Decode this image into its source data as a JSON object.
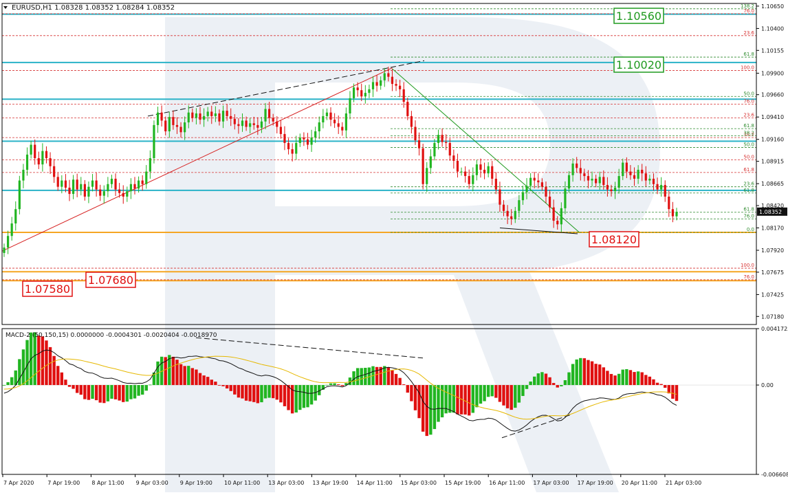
{
  "header": {
    "symbol_line": "EURUSD,H1  1.08328 1.08352 1.08284 1.08352",
    "macd_line": "MACD-2 (50,150,15) 0.0000000 -0.0004301 -0.0020404 -0.0018970"
  },
  "colors": {
    "bull": "#21b521",
    "bear": "#e01010",
    "level_cyan": "#2ab3c8",
    "level_orange": "#f5a623",
    "fib_red": "#d63030",
    "fib_green": "#2e8b2e",
    "trend_red": "#d62020",
    "trend_green": "#1f9a1f",
    "watermark": "#e9edf3"
  },
  "chart_data": [
    {
      "type": "candlestick",
      "title": "EURUSD,H1",
      "ylim": [
        1.0709,
        1.1068
      ],
      "y_ticks": [
        "1.10650",
        "1.10400",
        "1.10155",
        "1.09900",
        "1.09660",
        "1.09410",
        "1.09160",
        "1.08915",
        "1.08665",
        "1.08420",
        "1.08170",
        "1.07920",
        "1.07675",
        "1.07425",
        "1.07180"
      ],
      "x_ticks": [
        "7 Apr 2020",
        "7 Apr 19:00",
        "8 Apr 11:00",
        "9 Apr 03:00",
        "9 Apr 19:00",
        "10 Apr 11:00",
        "13 Apr 03:00",
        "13 Apr 19:00",
        "14 Apr 11:00",
        "15 Apr 03:00",
        "15 Apr 19:00",
        "16 Apr 11:00",
        "17 Apr 03:00",
        "17 Apr 19:00",
        "20 Apr 11:00",
        "21 Apr 03:00"
      ],
      "current_price": "1.08352",
      "series": [
        {
          "values": [
            1.0795,
            1.0808,
            1.0822,
            1.0838,
            1.087,
            1.0882,
            1.0899,
            1.091,
            1.0895,
            1.0888,
            1.0903,
            1.0895,
            1.0886,
            1.0874,
            1.0863,
            1.087,
            1.0862,
            1.0855,
            1.0871,
            1.086,
            1.0866,
            1.0852,
            1.0863,
            1.087,
            1.086,
            1.0853,
            1.0858,
            1.0866,
            1.0872,
            1.086,
            1.0856,
            1.0852,
            1.0858,
            1.0866,
            1.0861,
            1.087,
            1.0866,
            1.088,
            1.0895,
            1.0932,
            1.0946,
            1.0937,
            1.0925,
            1.0941,
            1.0932,
            1.093,
            1.0924,
            1.0935,
            1.0946,
            1.094,
            1.0945,
            1.0938,
            1.0942,
            1.0947,
            1.0942,
            1.0945,
            1.0936,
            1.0948,
            1.0942,
            1.0939,
            1.0933,
            1.0931,
            1.0937,
            1.093,
            1.0934,
            1.0932,
            1.0929,
            1.0936,
            1.095,
            1.094,
            1.0936,
            1.093,
            1.0922,
            1.0912,
            1.0905,
            1.09,
            1.0912,
            1.0918,
            1.0916,
            1.091,
            1.0918,
            1.0925,
            1.0935,
            1.0942,
            1.0946,
            1.0938,
            1.0934,
            1.093,
            1.0926,
            1.0945,
            1.0962,
            1.0974,
            1.0971,
            1.0964,
            1.0968,
            1.0972,
            1.098,
            1.0976,
            1.0982,
            1.099,
            1.0986,
            1.0978,
            1.0976,
            1.0972,
            1.0958,
            1.0942,
            1.093,
            1.0915,
            1.0906,
            1.0866,
            1.0884,
            1.0897,
            1.0912,
            1.0921,
            1.0913,
            1.0912,
            1.0898,
            1.0892,
            1.088,
            1.088,
            1.0875,
            1.0866,
            1.0876,
            1.0888,
            1.0882,
            1.0878,
            1.0886,
            1.0872,
            1.086,
            1.0843,
            1.0836,
            1.083,
            1.0827,
            1.0836,
            1.0848,
            1.0857,
            1.0864,
            1.0873,
            1.087,
            1.0868,
            1.0863,
            1.0852,
            1.084,
            1.0825,
            1.0821,
            1.0839,
            1.0861,
            1.0876,
            1.0889,
            1.0884,
            1.0878,
            1.0875,
            1.087,
            1.0872,
            1.0867,
            1.0874,
            1.0865,
            1.086,
            1.0858,
            1.0862,
            1.0875,
            1.089,
            1.088,
            1.0876,
            1.0872,
            1.0882,
            1.0878,
            1.087,
            1.0872,
            1.0866,
            1.086,
            1.0865,
            1.0852,
            1.0838,
            1.083,
            1.0835
          ]
        }
      ],
      "levels": [
        {
          "price": 1.1056,
          "label": "1.10560",
          "kind": "cyan",
          "box": "green"
        },
        {
          "price": 1.1002,
          "label": "1.10020",
          "kind": "cyan",
          "box": "green"
        },
        {
          "price": 1.0961,
          "kind": "cyan"
        },
        {
          "price": 1.0914,
          "kind": "cyan"
        },
        {
          "price": 1.0859,
          "kind": "cyan"
        },
        {
          "price": 1.0812,
          "label": "1.08120",
          "kind": "orange",
          "box": "red"
        },
        {
          "price": 1.0768,
          "label": "1.07680",
          "kind": "orange",
          "box": "red"
        },
        {
          "price": 1.0758,
          "label": "1.07580",
          "kind": "orange",
          "box": "red"
        }
      ],
      "fib_sets": [
        {
          "color": "red",
          "labels": [
            {
              "text": "76.0",
              "p": 1.10565
            },
            {
              "text": "23.6",
              "p": 1.1032
            },
            {
              "text": "100.0",
              "p": 1.0993
            },
            {
              "text": "76.0",
              "p": 1.09555
            },
            {
              "text": "23.6",
              "p": 1.094
            },
            {
              "text": "38.2",
              "p": 1.0918
            },
            {
              "text": "50.0",
              "p": 1.0893
            },
            {
              "text": "61.8",
              "p": 1.0879
            },
            {
              "text": "100.0",
              "p": 1.0772
            },
            {
              "text": "76.0",
              "p": 1.0759
            }
          ]
        },
        {
          "color": "green",
          "labels": [
            {
              "text": "138.2",
              "p": 1.1062
            },
            {
              "text": "61.8",
              "p": 1.1008
            },
            {
              "text": "50.0",
              "p": 1.0964
            },
            {
              "text": "61.8",
              "p": 1.0928
            },
            {
              "text": "38.2",
              "p": 1.092
            },
            {
              "text": "50.0",
              "p": 1.0907
            },
            {
              "text": "23.6",
              "p": 1.0863
            },
            {
              "text": "61.8",
              "p": 1.0856
            },
            {
              "text": "61.8",
              "p": 1.08345
            },
            {
              "text": "76.0",
              "p": 1.0827
            },
            {
              "text": "0.0",
              "p": 1.0812
            }
          ]
        }
      ]
    },
    {
      "type": "bar",
      "title": "MACD-2 (50,150,15)",
      "ylim": [
        -0.006608,
        0.0041725
      ],
      "y_ticks": [
        "0.0041725",
        "0.00",
        "-0.006608"
      ]
    }
  ]
}
